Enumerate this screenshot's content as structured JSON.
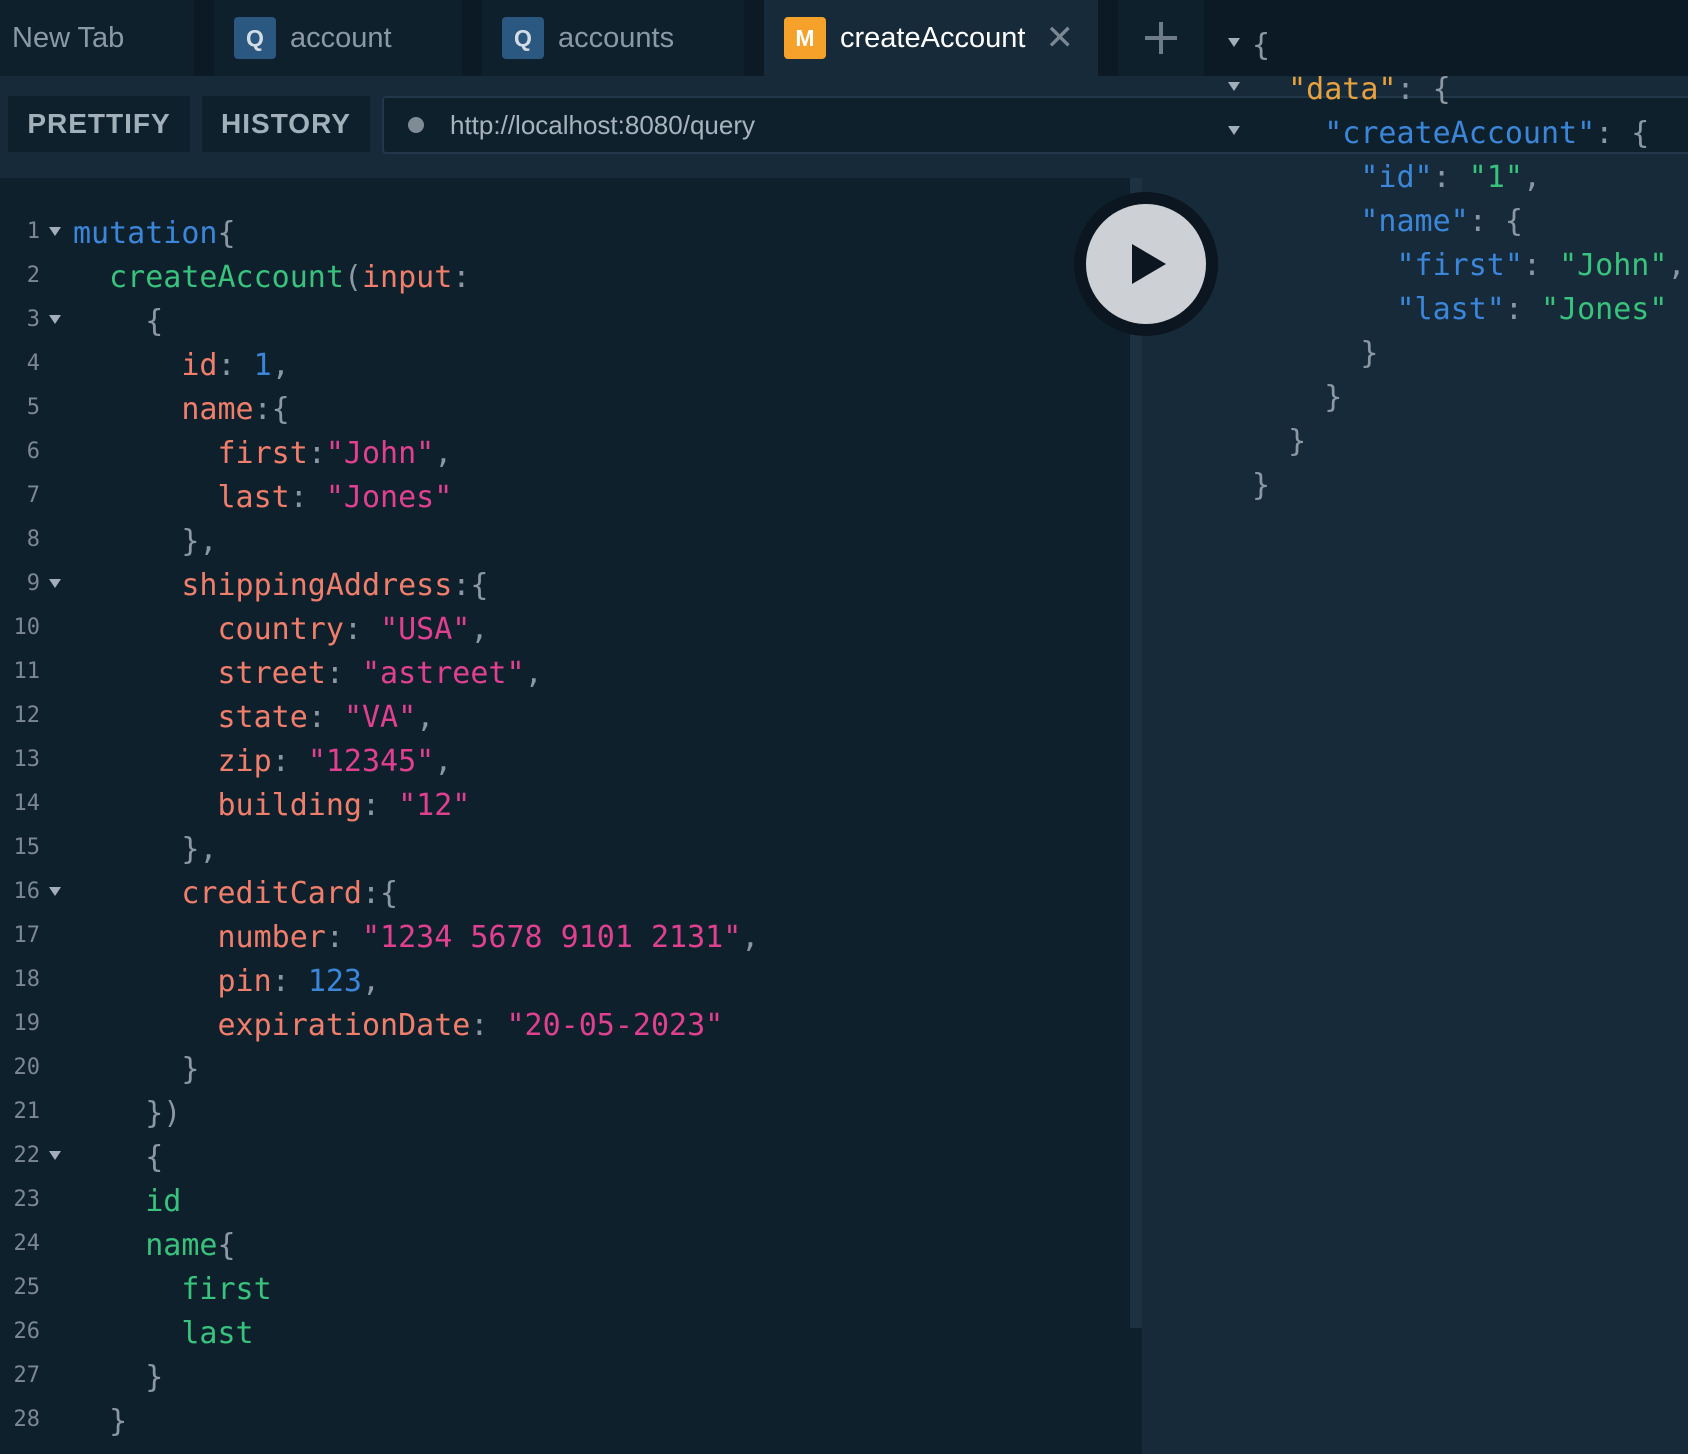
{
  "tabs": [
    {
      "label": "New Tab",
      "badge": "",
      "active": false
    },
    {
      "label": "account",
      "badge": "Q",
      "active": false
    },
    {
      "label": "accounts",
      "badge": "Q",
      "active": false
    },
    {
      "label": "createAccount",
      "badge": "M",
      "active": true
    }
  ],
  "tab_icons": {
    "close": "close-icon",
    "add": "plus-icon"
  },
  "toolbar": {
    "prettify_label": "PRETTIFY",
    "history_label": "HISTORY",
    "endpoint_url": "http://localhost:8080/query"
  },
  "editor": {
    "line_numbers": [
      "1",
      "2",
      "3",
      "4",
      "5",
      "6",
      "7",
      "8",
      "9",
      "10",
      "11",
      "12",
      "13",
      "14",
      "15",
      "16",
      "17",
      "18",
      "19",
      "20",
      "21",
      "22",
      "23",
      "24",
      "25",
      "26",
      "27",
      "28"
    ],
    "folded_lines": [
      1,
      3,
      9,
      16,
      22
    ],
    "query": {
      "l1_keyword": "mutation",
      "l2_field": "createAccount",
      "l2_arg": "input",
      "l4_key": "id",
      "l4_val": "1",
      "l5_key": "name",
      "l6_key": "first",
      "l6_val": "\"John\"",
      "l7_key": "last",
      "l7_val": "\"Jones\"",
      "l9_key": "shippingAddress",
      "l10_key": "country",
      "l10_val": "\"USA\"",
      "l11_key": "street",
      "l11_val": "\"astreet\"",
      "l12_key": "state",
      "l12_val": "\"VA\"",
      "l13_key": "zip",
      "l13_val": "\"12345\"",
      "l14_key": "building",
      "l14_val": "\"12\"",
      "l16_key": "creditCard",
      "l17_key": "number",
      "l17_val": "\"1234 5678 9101 2131\"",
      "l18_key": "pin",
      "l18_val": "123",
      "l19_key": "expirationDate",
      "l19_val": "\"20-05-2023\"",
      "l23_sel": "id",
      "l24_sel": "name",
      "l25_sel": "first",
      "l26_sel": "last"
    }
  },
  "run_button": {
    "icon": "play-icon"
  },
  "result": {
    "folded_lines": [
      1,
      2,
      3
    ],
    "k_data": "\"data\"",
    "k_createAccount": "\"createAccount\"",
    "k_id": "\"id\"",
    "v_id": "\"1\"",
    "k_name": "\"name\"",
    "k_first": "\"first\"",
    "v_first": "\"John\"",
    "k_last": "\"last\"",
    "v_last": "\"Jones\""
  },
  "colors": {
    "bg_editor": "#0f202d",
    "bg_result": "#172a3a",
    "keyword": "#3b86d9",
    "field": "#38c27c",
    "argument": "#f07e6b",
    "string": "#e0408f",
    "mutation_badge": "#f6a22a",
    "query_badge": "#2a5880"
  }
}
